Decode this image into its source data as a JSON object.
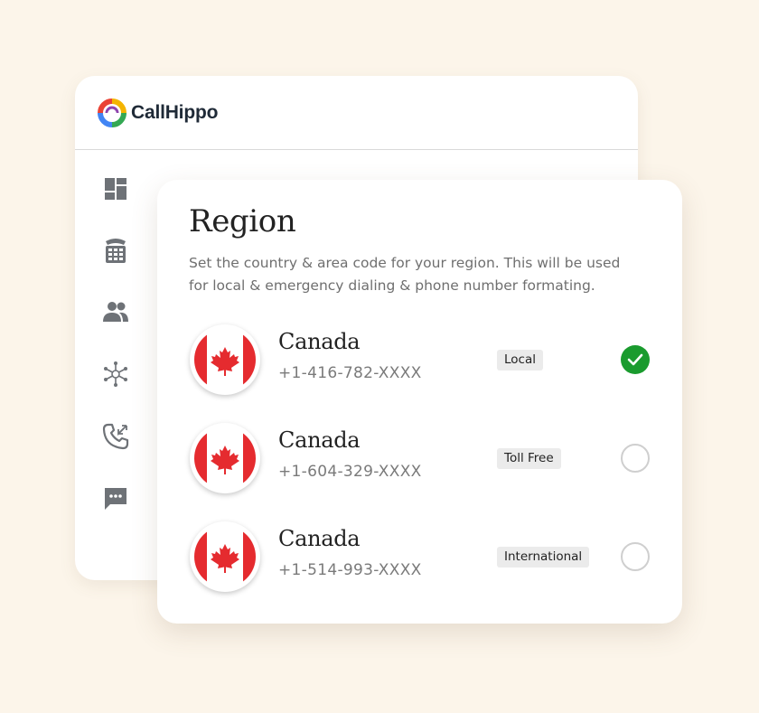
{
  "app": {
    "brand_name": "CallHippo"
  },
  "sidebar": {
    "items": [
      {
        "icon": "dashboard-icon"
      },
      {
        "icon": "dialpad-icon"
      },
      {
        "icon": "users-icon"
      },
      {
        "icon": "integrations-icon"
      },
      {
        "icon": "call-log-icon"
      },
      {
        "icon": "sms-icon"
      }
    ]
  },
  "region": {
    "title": "Region",
    "description": "Set the country & area code for your region. This will be used for local & emergency dialing & phone number formating.",
    "options": [
      {
        "country": "Canada",
        "phone": "+1-416-782-XXXX",
        "type": "Local",
        "selected": true
      },
      {
        "country": "Canada",
        "phone": "+1-604-329-XXXX",
        "type": "Toll Free",
        "selected": false
      },
      {
        "country": "Canada",
        "phone": "+1-514-993-XXXX",
        "type": "International",
        "selected": false
      }
    ]
  },
  "colors": {
    "background": "#fcf5ea",
    "selected_green": "#1a9b2e",
    "flag_red": "#e52b2f",
    "icon_gray": "#6e7277"
  }
}
